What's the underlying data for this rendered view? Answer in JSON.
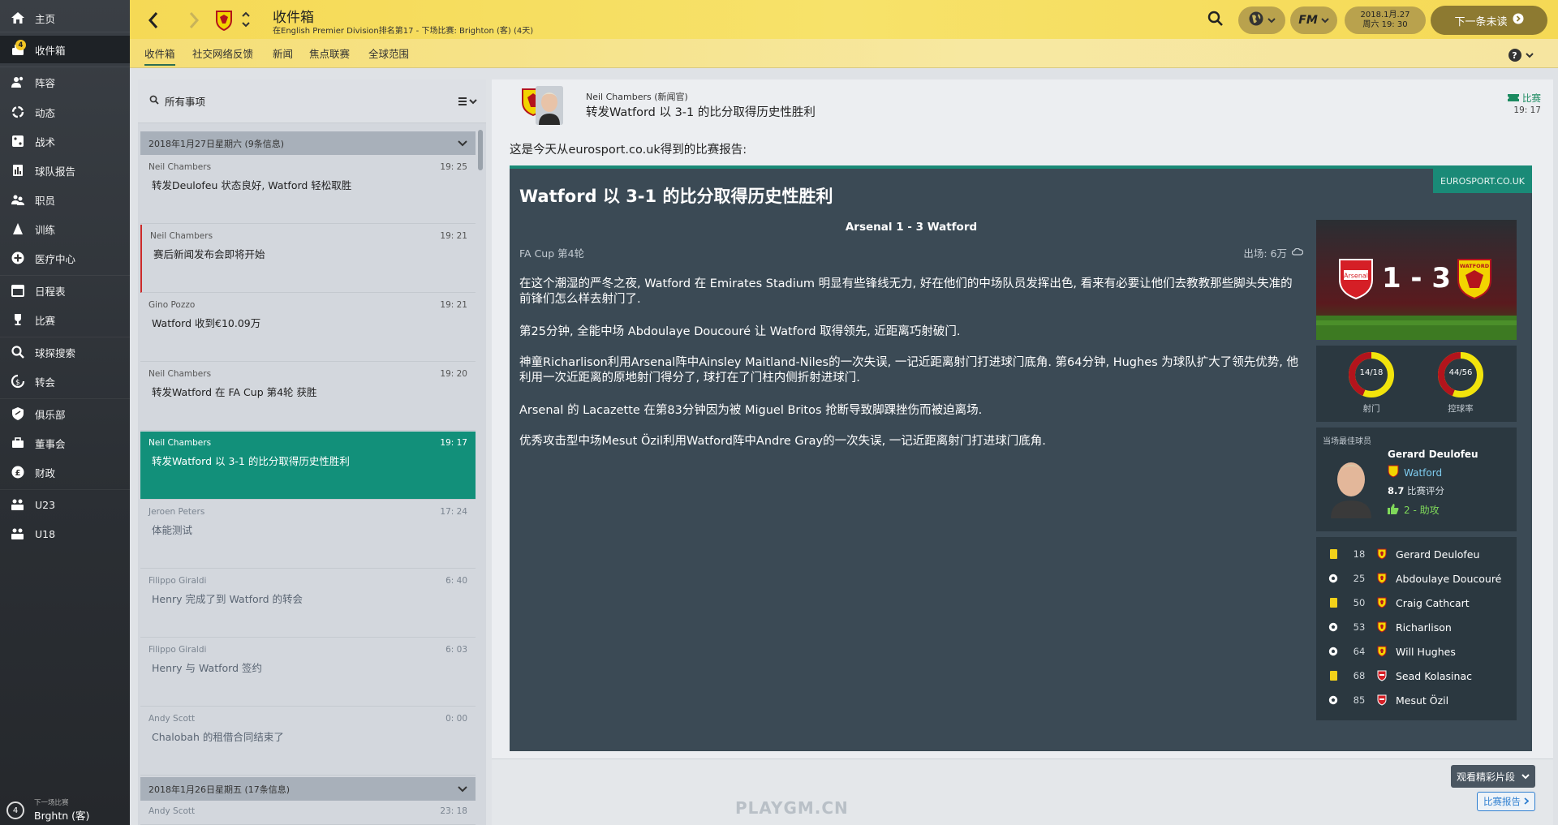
{
  "sidebar": {
    "inbox_badge": "4",
    "items": [
      {
        "label": "主页",
        "icon": "home-icon"
      },
      {
        "label": "收件箱",
        "icon": "inbox-icon"
      },
      {
        "label": "阵容",
        "icon": "squad-icon"
      },
      {
        "label": "动态",
        "icon": "dynamics-icon"
      },
      {
        "label": "战术",
        "icon": "tactics-icon"
      },
      {
        "label": "球队报告",
        "icon": "team-report-icon"
      },
      {
        "label": "职员",
        "icon": "staff-icon"
      },
      {
        "label": "训练",
        "icon": "training-icon"
      },
      {
        "label": "医疗中心",
        "icon": "medical-icon"
      },
      {
        "label": "日程表",
        "icon": "calendar-icon"
      },
      {
        "label": "比赛",
        "icon": "trophy-icon"
      },
      {
        "label": "球探搜索",
        "icon": "search-icon"
      },
      {
        "label": "转会",
        "icon": "transfer-icon"
      },
      {
        "label": "俱乐部",
        "icon": "club-icon"
      },
      {
        "label": "董事会",
        "icon": "board-icon"
      },
      {
        "label": "财政",
        "icon": "finance-icon"
      },
      {
        "label": "U23",
        "icon": "u23-icon"
      },
      {
        "label": "U18",
        "icon": "u18-icon"
      }
    ],
    "next_match_number": "4",
    "next_match_label": "下一场比赛",
    "next_match_value": "Brghtn (客)"
  },
  "header": {
    "title": "收件箱",
    "subtitle": "在English Premier Division排名第17 - 下场比赛: Brighton (客) (4天)",
    "date_line1": "2018.1月.27",
    "date_line2": "周六 19: 30",
    "continue_label": "下一条未读",
    "fm_label": "FM"
  },
  "subnav": {
    "tabs": [
      "收件箱",
      "社交网络反馈",
      "新闻",
      "焦点联赛",
      "全球范围"
    ],
    "help": "?"
  },
  "list": {
    "search_label": "所有事项",
    "group1": "2018年1月27日星期六 (9条信息)",
    "group2": "2018年1月26日星期五 (17条信息)",
    "messages": [
      {
        "from": "Neil Chambers",
        "time": "19: 25",
        "subject": "转发Deulofeu 状态良好, Watford 轻松取胜"
      },
      {
        "from": "Neil Chambers",
        "time": "19: 21",
        "subject": "赛后新闻发布会即将开始"
      },
      {
        "from": "Gino Pozzo",
        "time": "19: 21",
        "subject": "Watford 收到€10.09万"
      },
      {
        "from": "Neil Chambers",
        "time": "19: 20",
        "subject": "转发Watford 在 FA Cup 第4轮 获胜"
      },
      {
        "from": "Neil Chambers",
        "time": "19: 17",
        "subject": "转发Watford 以 3-1 的比分取得历史性胜利"
      },
      {
        "from": "Jeroen Peters",
        "time": "17: 24",
        "subject": "体能测试"
      },
      {
        "from": "Filippo Giraldi",
        "time": "6: 40",
        "subject": "Henry 完成了到 Watford 的转会"
      },
      {
        "from": "Filippo Giraldi",
        "time": "6: 03",
        "subject": "Henry 与 Watford 签约"
      },
      {
        "from": "Andy Scott",
        "time": "0: 00",
        "subject": "Chalobah 的租借合同结束了"
      }
    ],
    "trailing_from": "Andy Scott",
    "trailing_time": "23: 18"
  },
  "message": {
    "sender": "Neil Chambers  (新闻官)",
    "subject": "转发Watford 以 3-1 的比分取得历史性胜利",
    "tag": "比赛",
    "time": "19: 17",
    "intro": "这是今天从eurosport.co.uk得到的比赛报告:"
  },
  "article": {
    "source": "EUROSPORT.CO.UK",
    "headline": "Watford 以 3-1 的比分取得历史性胜利",
    "match_title": "Arsenal 1 - 3 Watford",
    "competition": "FA Cup 第4轮",
    "attendance": "出场: 6万",
    "p1": "在这个潮湿的严冬之夜, Watford 在 Emirates Stadium 明显有些锋线无力, 好在他们的中场队员发挥出色, 看来有必要让他们去教教那些脚头失准的前锋们怎么样去射门了.",
    "p2": "第25分钟, 全能中场 Abdoulaye Doucouré 让 Watford 取得领先, 近距离巧射破门.",
    "p3": "神童Richarlison利用Arsenal阵中Ainsley Maitland-Niles的一次失误, 一记近距离射门打进球门底角. 第64分钟, Hughes 为球队扩大了领先优势, 他利用一次近距离的原地射门得分了, 球打在了门柱内侧折射进球门.",
    "p4": "Arsenal 的 Lacazette 在第83分钟因为被 Miguel Britos 抢断导致脚踝挫伤而被迫离场.",
    "p5": "优秀攻击型中场Mesut Özil利用Watford阵中Andre Gray的一次失误, 一记近距离射门打进球门底角.",
    "score": "1 - 3",
    "home_badge_text": "Arsenal",
    "away_badge_text": "WATFORD",
    "shots_value": "14/18",
    "shots_label": "射门",
    "possession_value": "44/56",
    "possession_label": "控球率",
    "shots_home_fraction": 0.4375,
    "possession_home_fraction": 0.44,
    "potm_label": "当场最佳球员",
    "potm_name": "Gerard Deulofeu",
    "potm_club": "Watford",
    "potm_rating": "8.7",
    "potm_rating_label": "比赛评分",
    "potm_assists": "2 - 助攻",
    "events": [
      {
        "minute": "18",
        "type": "yellow-card",
        "team": "watford",
        "player": "Gerard Deulofeu"
      },
      {
        "minute": "25",
        "type": "goal",
        "team": "watford",
        "player": "Abdoulaye Doucouré"
      },
      {
        "minute": "50",
        "type": "yellow-card",
        "team": "watford",
        "player": "Craig Cathcart"
      },
      {
        "minute": "53",
        "type": "goal",
        "team": "watford",
        "player": "Richarlison"
      },
      {
        "minute": "64",
        "type": "goal",
        "team": "watford",
        "player": "Will Hughes"
      },
      {
        "minute": "68",
        "type": "yellow-card",
        "team": "arsenal",
        "player": "Sead Kolasinac"
      },
      {
        "minute": "85",
        "type": "goal",
        "team": "arsenal",
        "player": "Mesut Özil"
      }
    ]
  },
  "footer": {
    "highlights_label": "观看精彩片段",
    "report_label": "比赛报告",
    "watermark": "PLAYGM.CN"
  },
  "colors": {
    "header_yellow": "#f5d955",
    "selected_teal": "#12907a",
    "article_bg": "#3b4a55",
    "ring_yellow": "#f2e40c",
    "ring_red": "#b3141c"
  }
}
